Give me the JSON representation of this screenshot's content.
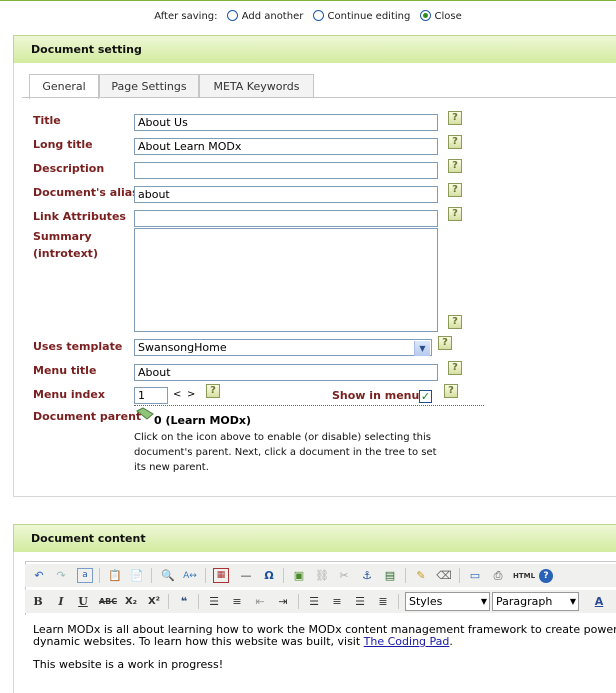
{
  "after_saving": {
    "label": "After saving:",
    "options": [
      {
        "label": "Add another",
        "checked": false
      },
      {
        "label": "Continue editing",
        "checked": false
      },
      {
        "label": "Close",
        "checked": true
      }
    ]
  },
  "document_setting": {
    "header": "Document setting",
    "tabs": [
      "General",
      "Page Settings",
      "META Keywords"
    ],
    "active_tab": "General",
    "fields": {
      "title": {
        "label": "Title",
        "value": "About Us"
      },
      "long_title": {
        "label": "Long title",
        "value": "About Learn MODx"
      },
      "description": {
        "label": "Description",
        "value": ""
      },
      "alias": {
        "label": "Document's alias",
        "value": "about"
      },
      "link_attributes": {
        "label": "Link Attributes",
        "value": ""
      },
      "summary": {
        "label_line1": "Summary",
        "label_line2": "(introtext)",
        "value": ""
      },
      "template": {
        "label": "Uses template",
        "value": "SwansongHome"
      },
      "menu_title": {
        "label": "Menu title",
        "value": "About"
      },
      "menu_index": {
        "label": "Menu index",
        "value": "1",
        "less": "<",
        "more": ">"
      },
      "show_in_menu": {
        "label": "Show in menu",
        "checked": true
      },
      "parent": {
        "label": "Document parent",
        "value": "0 (Learn MODx)",
        "description": "Click on the icon above to enable (or disable) selecting this document's parent. Next, click a document in the tree to set its new parent."
      }
    },
    "help_glyph": "?"
  },
  "document_content": {
    "header": "Document content",
    "toolbar": {
      "bold": "B",
      "italic": "I",
      "underline": "U",
      "strike": "ABC",
      "subscript": "X₂",
      "superscript": "X²",
      "html": "HTML",
      "help": "?",
      "styles": "Styles",
      "format": "Paragraph"
    },
    "paragraph1_line1": "Learn MODx is all about learning how to work the MODx content management framework to create powerful",
    "paragraph1_line2": "dynamic websites.  To learn how this website was built, visit ",
    "link_text": "The Coding Pad",
    "link_after": ".",
    "paragraph2": "This website is a work in progress!"
  },
  "colors": {
    "accent_green": "#7fb53a",
    "label_red": "#7a1f1f",
    "link_blue": "#1a1aa6"
  }
}
